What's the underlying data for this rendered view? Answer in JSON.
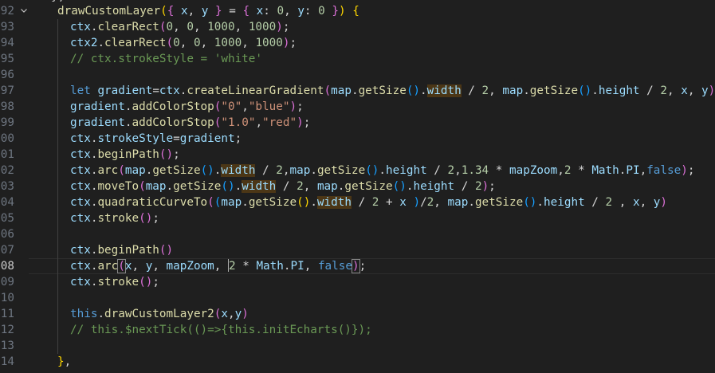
{
  "editor": {
    "top_partial": "},",
    "lines": [
      {
        "num": "92",
        "fold": true,
        "indent": 0,
        "tokens": [
          {
            "t": "drawCustomLayer",
            "c": "fn"
          },
          {
            "t": "(",
            "c": "b1"
          },
          {
            "t": "{ ",
            "c": "b2"
          },
          {
            "t": "x",
            "c": "var"
          },
          {
            "t": ", ",
            "c": "pl"
          },
          {
            "t": "y",
            "c": "var"
          },
          {
            "t": " } ",
            "c": "b2"
          },
          {
            "t": "= ",
            "c": "pl"
          },
          {
            "t": "{ ",
            "c": "b2"
          },
          {
            "t": "x",
            "c": "var"
          },
          {
            "t": ": ",
            "c": "pl"
          },
          {
            "t": "0",
            "c": "num"
          },
          {
            "t": ", ",
            "c": "pl"
          },
          {
            "t": "y",
            "c": "var"
          },
          {
            "t": ": ",
            "c": "pl"
          },
          {
            "t": "0",
            "c": "num"
          },
          {
            "t": " }",
            "c": "b2"
          },
          {
            "t": ") ",
            "c": "b1"
          },
          {
            "t": "{",
            "c": "b1"
          }
        ]
      },
      {
        "num": "93",
        "indent": 1,
        "tokens": [
          {
            "t": "ctx",
            "c": "var"
          },
          {
            "t": ".",
            "c": "pl"
          },
          {
            "t": "clearRect",
            "c": "fn"
          },
          {
            "t": "(",
            "c": "b2"
          },
          {
            "t": "0",
            "c": "num"
          },
          {
            "t": ", ",
            "c": "pl"
          },
          {
            "t": "0",
            "c": "num"
          },
          {
            "t": ", ",
            "c": "pl"
          },
          {
            "t": "1000",
            "c": "num"
          },
          {
            "t": ", ",
            "c": "pl"
          },
          {
            "t": "1000",
            "c": "num"
          },
          {
            "t": ")",
            "c": "b2"
          },
          {
            "t": ";",
            "c": "pl"
          }
        ]
      },
      {
        "num": "94",
        "indent": 1,
        "tokens": [
          {
            "t": "ctx2",
            "c": "var"
          },
          {
            "t": ".",
            "c": "pl"
          },
          {
            "t": "clearRect",
            "c": "fn"
          },
          {
            "t": "(",
            "c": "b2"
          },
          {
            "t": "0",
            "c": "num"
          },
          {
            "t": ", ",
            "c": "pl"
          },
          {
            "t": "0",
            "c": "num"
          },
          {
            "t": ", ",
            "c": "pl"
          },
          {
            "t": "1000",
            "c": "num"
          },
          {
            "t": ", ",
            "c": "pl"
          },
          {
            "t": "1000",
            "c": "num"
          },
          {
            "t": ")",
            "c": "b2"
          },
          {
            "t": ";",
            "c": "pl"
          }
        ]
      },
      {
        "num": "95",
        "indent": 1,
        "tokens": [
          {
            "t": "// ctx.strokeStyle = 'white'",
            "c": "cmt"
          }
        ]
      },
      {
        "num": "96",
        "indent": 1,
        "tokens": []
      },
      {
        "num": "97",
        "indent": 1,
        "tokens": [
          {
            "t": "let ",
            "c": "kw"
          },
          {
            "t": "gradient",
            "c": "var"
          },
          {
            "t": "=",
            "c": "pl"
          },
          {
            "t": "ctx",
            "c": "var"
          },
          {
            "t": ".",
            "c": "pl"
          },
          {
            "t": "createLinearGradient",
            "c": "fn"
          },
          {
            "t": "(",
            "c": "b2"
          },
          {
            "t": "map",
            "c": "var"
          },
          {
            "t": ".",
            "c": "pl"
          },
          {
            "t": "getSize",
            "c": "fn"
          },
          {
            "t": "()",
            "c": "b3"
          },
          {
            "t": ".",
            "c": "pl"
          },
          {
            "t": "width",
            "c": "var",
            "hl": true
          },
          {
            "t": " / ",
            "c": "pl"
          },
          {
            "t": "2",
            "c": "num"
          },
          {
            "t": ", ",
            "c": "pl"
          },
          {
            "t": "map",
            "c": "var"
          },
          {
            "t": ".",
            "c": "pl"
          },
          {
            "t": "getSize",
            "c": "fn"
          },
          {
            "t": "()",
            "c": "b3"
          },
          {
            "t": ".",
            "c": "pl"
          },
          {
            "t": "height",
            "c": "var"
          },
          {
            "t": " / ",
            "c": "pl"
          },
          {
            "t": "2",
            "c": "num"
          },
          {
            "t": ", ",
            "c": "pl"
          },
          {
            "t": "x",
            "c": "var"
          },
          {
            "t": ", ",
            "c": "pl"
          },
          {
            "t": "y",
            "c": "var"
          },
          {
            "t": ")",
            "c": "b2"
          },
          {
            "t": ";",
            "c": "pl"
          }
        ]
      },
      {
        "num": "98",
        "indent": 1,
        "tokens": [
          {
            "t": "gradient",
            "c": "var"
          },
          {
            "t": ".",
            "c": "pl"
          },
          {
            "t": "addColorStop",
            "c": "fn"
          },
          {
            "t": "(",
            "c": "b2"
          },
          {
            "t": "\"0\"",
            "c": "str"
          },
          {
            "t": ",",
            "c": "pl"
          },
          {
            "t": "\"blue\"",
            "c": "str"
          },
          {
            "t": ")",
            "c": "b2"
          },
          {
            "t": ";",
            "c": "pl"
          }
        ]
      },
      {
        "num": "99",
        "indent": 1,
        "tokens": [
          {
            "t": "gradient",
            "c": "var"
          },
          {
            "t": ".",
            "c": "pl"
          },
          {
            "t": "addColorStop",
            "c": "fn"
          },
          {
            "t": "(",
            "c": "b2"
          },
          {
            "t": "\"1.0\"",
            "c": "str"
          },
          {
            "t": ",",
            "c": "pl"
          },
          {
            "t": "\"red\"",
            "c": "str"
          },
          {
            "t": ")",
            "c": "b2"
          },
          {
            "t": ";",
            "c": "pl"
          }
        ]
      },
      {
        "num": "00",
        "indent": 1,
        "tokens": [
          {
            "t": "ctx",
            "c": "var"
          },
          {
            "t": ".",
            "c": "pl"
          },
          {
            "t": "strokeStyle",
            "c": "var"
          },
          {
            "t": "=",
            "c": "pl"
          },
          {
            "t": "gradient",
            "c": "var"
          },
          {
            "t": ";",
            "c": "pl"
          }
        ]
      },
      {
        "num": "01",
        "indent": 1,
        "tokens": [
          {
            "t": "ctx",
            "c": "var"
          },
          {
            "t": ".",
            "c": "pl"
          },
          {
            "t": "beginPath",
            "c": "fn"
          },
          {
            "t": "()",
            "c": "b2"
          },
          {
            "t": ";",
            "c": "pl"
          }
        ]
      },
      {
        "num": "02",
        "indent": 1,
        "tokens": [
          {
            "t": "ctx",
            "c": "var"
          },
          {
            "t": ".",
            "c": "pl"
          },
          {
            "t": "arc",
            "c": "fn"
          },
          {
            "t": "(",
            "c": "b2"
          },
          {
            "t": "map",
            "c": "var"
          },
          {
            "t": ".",
            "c": "pl"
          },
          {
            "t": "getSize",
            "c": "fn"
          },
          {
            "t": "()",
            "c": "b3"
          },
          {
            "t": ".",
            "c": "pl"
          },
          {
            "t": "width",
            "c": "var",
            "hl": true
          },
          {
            "t": " / ",
            "c": "pl"
          },
          {
            "t": "2",
            "c": "num"
          },
          {
            "t": ",",
            "c": "pl"
          },
          {
            "t": "map",
            "c": "var"
          },
          {
            "t": ".",
            "c": "pl"
          },
          {
            "t": "getSize",
            "c": "fn"
          },
          {
            "t": "()",
            "c": "b3"
          },
          {
            "t": ".",
            "c": "pl"
          },
          {
            "t": "height",
            "c": "var"
          },
          {
            "t": " / ",
            "c": "pl"
          },
          {
            "t": "2",
            "c": "num"
          },
          {
            "t": ",",
            "c": "pl"
          },
          {
            "t": "1.34",
            "c": "num"
          },
          {
            "t": " * ",
            "c": "pl"
          },
          {
            "t": "mapZoom",
            "c": "var"
          },
          {
            "t": ",",
            "c": "pl"
          },
          {
            "t": "2",
            "c": "num"
          },
          {
            "t": " * ",
            "c": "pl"
          },
          {
            "t": "Math",
            "c": "var"
          },
          {
            "t": ".",
            "c": "pl"
          },
          {
            "t": "PI",
            "c": "var"
          },
          {
            "t": ",",
            "c": "pl"
          },
          {
            "t": "false",
            "c": "kw"
          },
          {
            "t": ")",
            "c": "b2"
          },
          {
            "t": ";",
            "c": "pl"
          }
        ]
      },
      {
        "num": "03",
        "indent": 1,
        "tokens": [
          {
            "t": "ctx",
            "c": "var"
          },
          {
            "t": ".",
            "c": "pl"
          },
          {
            "t": "moveTo",
            "c": "fn"
          },
          {
            "t": "(",
            "c": "b2"
          },
          {
            "t": "map",
            "c": "var"
          },
          {
            "t": ".",
            "c": "pl"
          },
          {
            "t": "getSize",
            "c": "fn"
          },
          {
            "t": "()",
            "c": "b3"
          },
          {
            "t": ".",
            "c": "pl"
          },
          {
            "t": "width",
            "c": "var",
            "hl": true
          },
          {
            "t": " / ",
            "c": "pl"
          },
          {
            "t": "2",
            "c": "num"
          },
          {
            "t": ", ",
            "c": "pl"
          },
          {
            "t": "map",
            "c": "var"
          },
          {
            "t": ".",
            "c": "pl"
          },
          {
            "t": "getSize",
            "c": "fn"
          },
          {
            "t": "()",
            "c": "b3"
          },
          {
            "t": ".",
            "c": "pl"
          },
          {
            "t": "height",
            "c": "var"
          },
          {
            "t": " / ",
            "c": "pl"
          },
          {
            "t": "2",
            "c": "num"
          },
          {
            "t": ")",
            "c": "b2"
          },
          {
            "t": ";",
            "c": "pl"
          }
        ]
      },
      {
        "num": "04",
        "indent": 1,
        "tokens": [
          {
            "t": "ctx",
            "c": "var"
          },
          {
            "t": ".",
            "c": "pl"
          },
          {
            "t": "quadraticCurveTo",
            "c": "fn"
          },
          {
            "t": "(",
            "c": "b2"
          },
          {
            "t": "(",
            "c": "b3"
          },
          {
            "t": "map",
            "c": "var"
          },
          {
            "t": ".",
            "c": "pl"
          },
          {
            "t": "getSize",
            "c": "fn"
          },
          {
            "t": "()",
            "c": "b1"
          },
          {
            "t": ".",
            "c": "pl"
          },
          {
            "t": "width",
            "c": "var",
            "hl": true
          },
          {
            "t": " / ",
            "c": "pl"
          },
          {
            "t": "2",
            "c": "num"
          },
          {
            "t": " + ",
            "c": "pl"
          },
          {
            "t": "x",
            "c": "var"
          },
          {
            "t": " )",
            "c": "b3"
          },
          {
            "t": "/",
            "c": "pl"
          },
          {
            "t": "2",
            "c": "num"
          },
          {
            "t": ", ",
            "c": "pl"
          },
          {
            "t": "map",
            "c": "var"
          },
          {
            "t": ".",
            "c": "pl"
          },
          {
            "t": "getSize",
            "c": "fn"
          },
          {
            "t": "()",
            "c": "b3"
          },
          {
            "t": ".",
            "c": "pl"
          },
          {
            "t": "height",
            "c": "var"
          },
          {
            "t": " / ",
            "c": "pl"
          },
          {
            "t": "2",
            "c": "num"
          },
          {
            "t": " , ",
            "c": "pl"
          },
          {
            "t": "x",
            "c": "var"
          },
          {
            "t": ", ",
            "c": "pl"
          },
          {
            "t": "y",
            "c": "var"
          },
          {
            "t": ")",
            "c": "b2"
          }
        ]
      },
      {
        "num": "05",
        "indent": 1,
        "tokens": [
          {
            "t": "ctx",
            "c": "var"
          },
          {
            "t": ".",
            "c": "pl"
          },
          {
            "t": "stroke",
            "c": "fn"
          },
          {
            "t": "()",
            "c": "b2"
          },
          {
            "t": ";",
            "c": "pl"
          }
        ]
      },
      {
        "num": "06",
        "indent": 1,
        "tokens": []
      },
      {
        "num": "07",
        "indent": 1,
        "tokens": [
          {
            "t": "ctx",
            "c": "var"
          },
          {
            "t": ".",
            "c": "pl"
          },
          {
            "t": "beginPath",
            "c": "fn"
          },
          {
            "t": "()",
            "c": "b2"
          }
        ]
      },
      {
        "num": "08",
        "indent": 1,
        "current": true,
        "tokens": [
          {
            "t": "ctx",
            "c": "var"
          },
          {
            "t": ".",
            "c": "pl"
          },
          {
            "t": "arc",
            "c": "fn"
          },
          {
            "t": "(",
            "c": "b2",
            "bm": true
          },
          {
            "t": "x",
            "c": "var"
          },
          {
            "t": ", ",
            "c": "pl"
          },
          {
            "t": "y",
            "c": "var"
          },
          {
            "t": ", ",
            "c": "pl"
          },
          {
            "t": "mapZoom",
            "c": "var"
          },
          {
            "t": ", ",
            "c": "pl"
          },
          {
            "t": "",
            "c": "cursor"
          },
          {
            "t": "2",
            "c": "num"
          },
          {
            "t": " * ",
            "c": "pl"
          },
          {
            "t": "Math",
            "c": "var"
          },
          {
            "t": ".",
            "c": "pl"
          },
          {
            "t": "PI",
            "c": "var"
          },
          {
            "t": ", ",
            "c": "pl"
          },
          {
            "t": "false",
            "c": "kw"
          },
          {
            "t": ")",
            "c": "b2",
            "bm": true
          },
          {
            "t": ";",
            "c": "pl"
          }
        ]
      },
      {
        "num": "09",
        "indent": 1,
        "tokens": [
          {
            "t": "ctx",
            "c": "var"
          },
          {
            "t": ".",
            "c": "pl"
          },
          {
            "t": "stroke",
            "c": "fn"
          },
          {
            "t": "()",
            "c": "b2"
          },
          {
            "t": ";",
            "c": "pl"
          }
        ]
      },
      {
        "num": "10",
        "indent": 1,
        "tokens": []
      },
      {
        "num": "11",
        "indent": 1,
        "tokens": [
          {
            "t": "this",
            "c": "kw"
          },
          {
            "t": ".",
            "c": "pl"
          },
          {
            "t": "drawCustomLayer2",
            "c": "fn"
          },
          {
            "t": "(",
            "c": "b2"
          },
          {
            "t": "x",
            "c": "var"
          },
          {
            "t": ",",
            "c": "pl"
          },
          {
            "t": "y",
            "c": "var"
          },
          {
            "t": ")",
            "c": "b2"
          }
        ]
      },
      {
        "num": "12",
        "indent": 1,
        "tokens": [
          {
            "t": "// this.$nextTick(()=>{this.initEcharts()});",
            "c": "cmt"
          }
        ]
      },
      {
        "num": "13",
        "indent": 1,
        "tokens": []
      },
      {
        "num": "14",
        "indent": 0,
        "tokens": [
          {
            "t": "}",
            "c": "b1"
          },
          {
            "t": ",",
            "c": "pl"
          }
        ]
      }
    ]
  }
}
